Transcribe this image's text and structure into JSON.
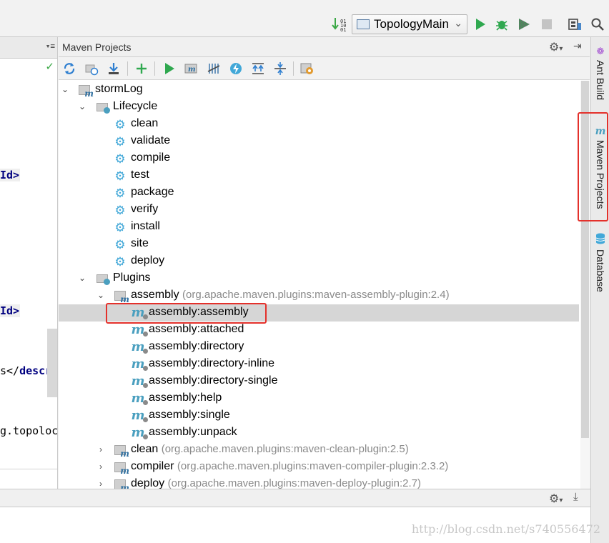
{
  "toolbar": {
    "run_config_label": "TopologyMain",
    "icons": [
      "sort-icon",
      "run-icon",
      "debug-icon",
      "coverage-icon",
      "stop-icon",
      "project-structure-icon",
      "search-icon"
    ]
  },
  "editor": {
    "lines": [
      {
        "text": "Id>",
        "tag": true
      },
      {
        "text": "Id>",
        "tag": true
      },
      {
        "pre": "s</",
        "tag_text": "descr",
        "tag": false
      },
      {
        "text": "g.topoloc",
        "tag": false
      }
    ]
  },
  "maven": {
    "title": "Maven Projects",
    "tree": {
      "project": "stormLog",
      "lifecycle": {
        "label": "Lifecycle",
        "phases": [
          "clean",
          "validate",
          "compile",
          "test",
          "package",
          "verify",
          "install",
          "site",
          "deploy"
        ]
      },
      "plugins": {
        "label": "Plugins",
        "expanded_plugin": {
          "name": "assembly",
          "coords": "(org.apache.maven.plugins:maven-assembly-plugin:2.4)",
          "goals": [
            "assembly:assembly",
            "assembly:attached",
            "assembly:directory",
            "assembly:directory-inline",
            "assembly:directory-single",
            "assembly:help",
            "assembly:single",
            "assembly:unpack"
          ],
          "selected_goal": "assembly:assembly"
        },
        "collapsed_plugins": [
          {
            "name": "clean",
            "coords": "(org.apache.maven.plugins:maven-clean-plugin:2.5)"
          },
          {
            "name": "compiler",
            "coords": "(org.apache.maven.plugins:maven-compiler-plugin:2.3.2)"
          },
          {
            "name": "deploy",
            "coords": "(org.apache.maven.plugins:maven-deploy-plugin:2.7)"
          }
        ]
      }
    }
  },
  "right_tabs": [
    "Ant Build",
    "Maven Projects",
    "Database"
  ],
  "watermark": "http://blog.csdn.net/s740556472",
  "colors": {
    "accent_blue": "#42a8d8",
    "highlight_red": "#e4312b",
    "run_green": "#2fa84f"
  }
}
